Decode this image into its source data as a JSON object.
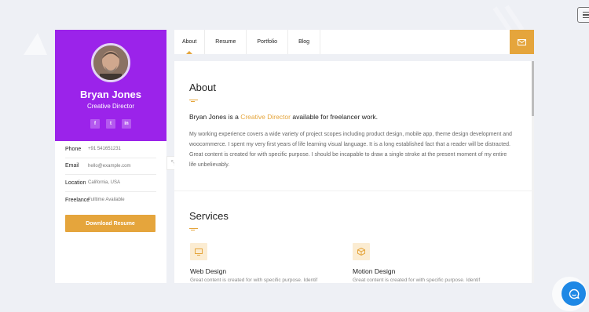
{
  "profile": {
    "name": "Bryan Jones",
    "role": "Creative Director",
    "socials": [
      "f",
      "t",
      "in"
    ],
    "info": [
      {
        "key": "Phone",
        "value": "+91 541651231"
      },
      {
        "key": "Email",
        "value": "hello@example.com"
      },
      {
        "key": "Location",
        "value": "California, USA"
      },
      {
        "key": "Freelance",
        "value": "Fulltime Available"
      }
    ],
    "download_label": "Download Resume"
  },
  "nav": {
    "tabs": [
      "About",
      "Resume",
      "Portfolio",
      "Blog"
    ],
    "active": "About"
  },
  "about": {
    "title": "About",
    "intro_prefix": "Bryan Jones is a ",
    "intro_highlight": "Creative Director",
    "intro_suffix": " available for freelancer work.",
    "paragraph": "My working experience covers a wide variety of project scopes including product design, mobile app, theme design development and woocommerce. I spent my very first years of life learning visual language. It is a long established fact that a reader will be distracted. Great content is created for with specific purpose. I should be incapable to draw a single stroke at the present moment of my entire life unbelievably."
  },
  "services": {
    "title": "Services",
    "items": [
      {
        "title": "Web Design",
        "desc": "Great content is created for with specific purpose. Identif",
        "icon": "monitor-icon"
      },
      {
        "title": "Motion Design",
        "desc": "Great content is created for with specific purpose. Identif",
        "icon": "cube-icon"
      }
    ]
  },
  "colors": {
    "accent": "#e5a53c",
    "brand": "#9b23ea",
    "chat": "#1e88e5"
  }
}
